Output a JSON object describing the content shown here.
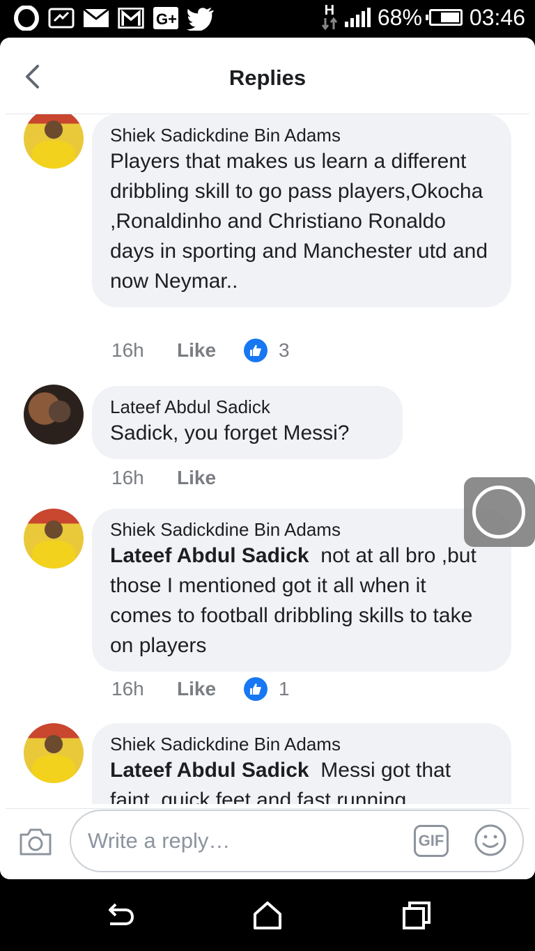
{
  "status_bar": {
    "network_type": "H",
    "battery_percent": "68%",
    "time": "03:46",
    "left_icons": [
      "opera-icon",
      "messenger-icon",
      "mail-icon",
      "gmail-icon",
      "google-plus-icon",
      "twitter-icon"
    ]
  },
  "header": {
    "title": "Replies"
  },
  "comments": [
    {
      "author": "Shiek Sadickdine Bin Adams",
      "mention": "",
      "text": "Players that makes us learn a different dribbling skill to go pass players,Okocha ,Ronaldinho and Christiano Ronaldo days in sporting and Manchester utd and now Neymar..",
      "time": "16h",
      "like_label": "Like",
      "reactions": "3"
    },
    {
      "author": "Lateef Abdul Sadick",
      "mention": "",
      "text": "Sadick, you forget Messi?",
      "time": "16h",
      "like_label": "Like",
      "reactions": ""
    },
    {
      "author": "Shiek Sadickdine Bin Adams",
      "mention": "Lateef Abdul Sadick",
      "text": "not at all bro ,but those I mentioned got it all when it comes to football dribbling skills to take on players",
      "time": "16h",
      "like_label": "Like",
      "reactions": "1"
    },
    {
      "author": "Shiek Sadickdine Bin Adams",
      "mention": "Lateef Abdul Sadick",
      "text": "Messi got that faint ,quick feet and fast running",
      "time": "",
      "like_label": "",
      "reactions": ""
    }
  ],
  "composer": {
    "placeholder": "Write a reply…",
    "gif_label": "GIF"
  },
  "colors": {
    "like_blue": "#1877f2",
    "bubble_bg": "#f0f2f5",
    "meta_gray": "#7a7d82"
  }
}
